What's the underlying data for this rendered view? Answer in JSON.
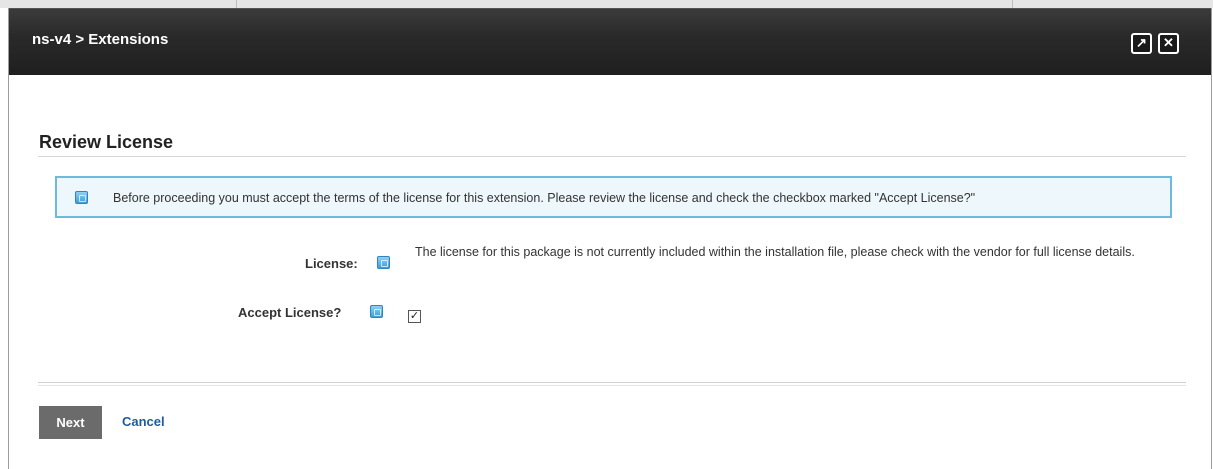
{
  "window": {
    "title": "ns-v4 > Extensions",
    "maximize_icon": "arrow-up-right-icon",
    "close_icon": "close-icon"
  },
  "page": {
    "heading": "Review License"
  },
  "notice": {
    "icon": "help-icon",
    "text": "Before proceeding you must accept the terms of the license for this extension. Please review the license and check the checkbox marked \"Accept License?\""
  },
  "form": {
    "license_label": "License:",
    "license_text": "The license for this package is not currently included within the installation file, please check with the vendor for full license details.",
    "accept_label": "Accept License?",
    "accept_checked": true
  },
  "actions": {
    "next_label": "Next",
    "cancel_label": "Cancel"
  },
  "colors": {
    "titlebar": "#222222",
    "notice_border": "#6bbbe0",
    "notice_bg": "#eef7fb",
    "next_button": "#6b6b6b",
    "link": "#1e5a9e"
  }
}
